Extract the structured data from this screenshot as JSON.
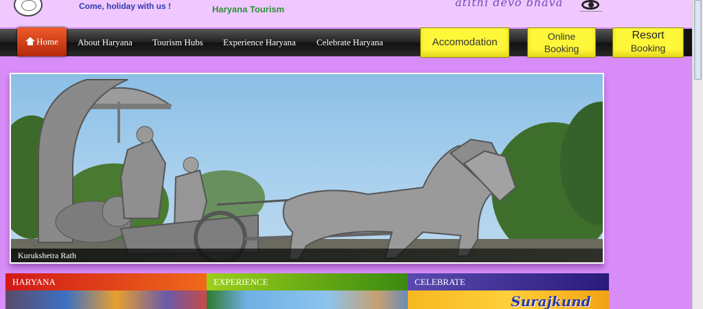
{
  "header": {
    "tagline": "Come, holiday with us !",
    "brand": "Haryana Tourism",
    "motto": "atithi devo bhava"
  },
  "nav": {
    "items": [
      {
        "label": "Home",
        "active": true
      },
      {
        "label": "About Haryana"
      },
      {
        "label": "Tourism Hubs"
      },
      {
        "label": "Experience Haryana"
      },
      {
        "label": "Celebrate Haryana"
      }
    ],
    "buttons": {
      "accomodation": "Accomodation",
      "online_line1": "Online",
      "online_line2": "Booking",
      "resort_line1": "Resort",
      "resort_line2": "Booking"
    },
    "button_color": "#fff83a",
    "home_color": "#d8401a"
  },
  "banner": {
    "caption": "Kurukshetra Rath"
  },
  "panels": [
    {
      "title": "HARYANA"
    },
    {
      "title": "EXPERIENCE"
    },
    {
      "title": "CELEBRATE",
      "image_text": "Surajkund"
    }
  ],
  "colors": {
    "page_background": "#d88cf8",
    "header_background": "#f0c8ff"
  }
}
